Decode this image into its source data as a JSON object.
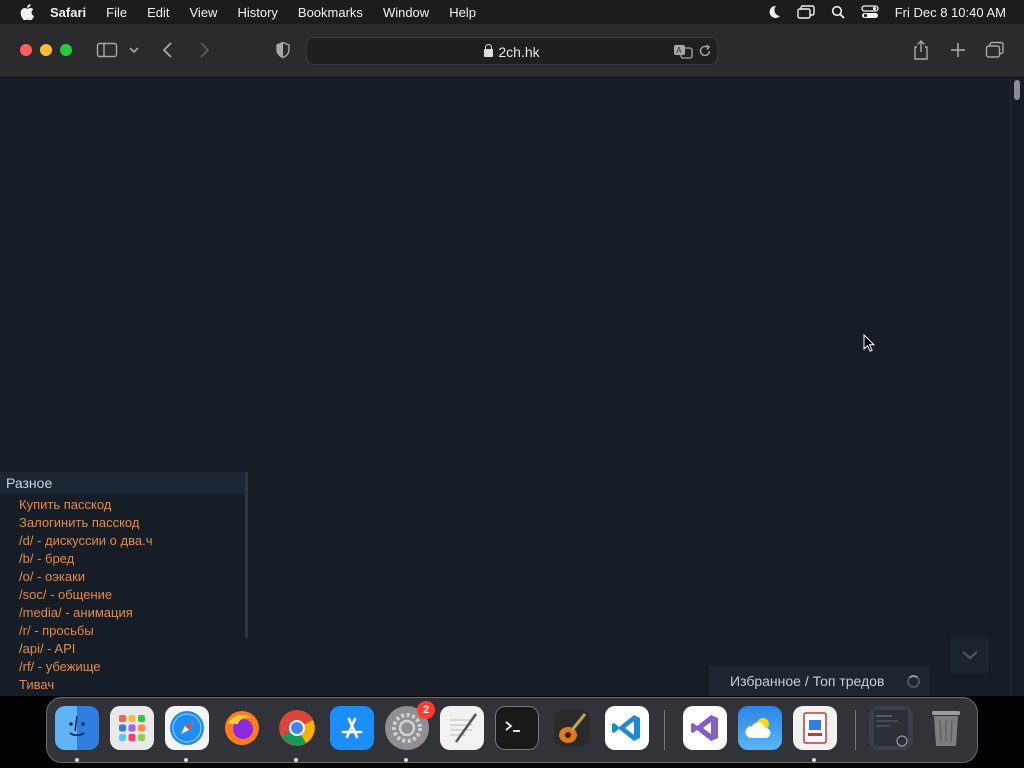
{
  "menubar": {
    "app_name": "Safari",
    "items": [
      "File",
      "Edit",
      "View",
      "History",
      "Bookmarks",
      "Window",
      "Help"
    ],
    "clock": "Fri Dec 8  10:40 AM"
  },
  "toolbar": {
    "url": "2ch.hk"
  },
  "sidebar": {
    "heading": "Разное",
    "links": [
      "Купить пасскод",
      "Залогинить пасскод",
      "/d/ - дискуссии о два.ч",
      "/b/ - бред",
      "/o/ - оэкаки",
      "/soc/ - общение",
      "/media/ - анимация",
      "/r/ - просьбы",
      "/api/ - API",
      "/rf/ - убежище",
      "Тивач"
    ]
  },
  "favorites": {
    "label": "Избранное / Топ тредов"
  },
  "dock": {
    "items": [
      "finder-icon",
      "launchpad-icon",
      "safari-icon",
      "firefox-icon",
      "chrome-icon",
      "app-store-icon",
      "system-settings-icon",
      "textedit-icon",
      "terminal-icon",
      "garageband-icon",
      "vscode-icon",
      "visual-studio-icon",
      "weather-icon",
      "remote-desktop-icon",
      "downloads-stack-icon",
      "trash-icon"
    ],
    "settings_badge": "2"
  },
  "colors": {
    "page_bg": "#161d27",
    "link": "#e38a4a",
    "toolbar_bg": "#2b2b2d"
  }
}
